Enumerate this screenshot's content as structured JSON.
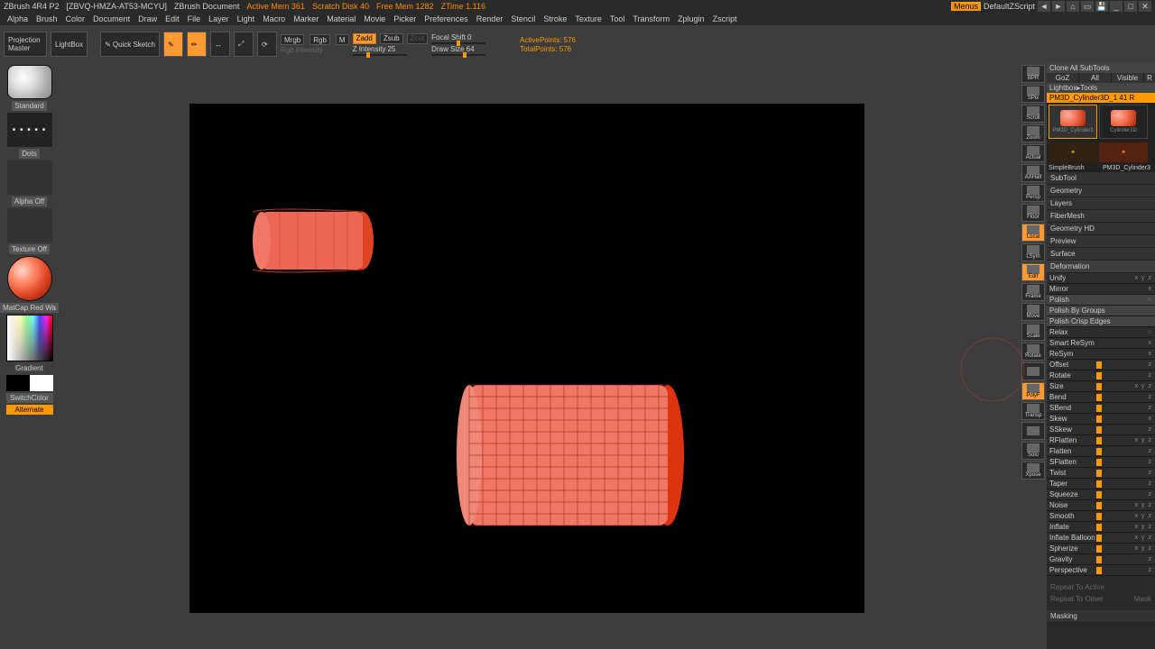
{
  "title": {
    "app": "ZBrush 4R4 P2",
    "doc": "[ZBVQ-HMZA-AT53-MCYU]",
    "doctype": "ZBrush Document",
    "mem": "Active Mem 361",
    "scratch": "Scratch Disk 40",
    "free": "Free Mem 1282",
    "ztime": "ZTime 1.116",
    "menus_btn": "Menus",
    "script_btn": "DefaultZScript"
  },
  "menubar": [
    "Alpha",
    "Brush",
    "Color",
    "Document",
    "Draw",
    "Edit",
    "File",
    "Layer",
    "Light",
    "Macro",
    "Marker",
    "Material",
    "Movie",
    "Picker",
    "Preferences",
    "Render",
    "Stencil",
    "Stroke",
    "Texture",
    "Tool",
    "Transform",
    "Zplugin",
    "Zscript"
  ],
  "shelf": {
    "projection_master": "Projection Master",
    "lightbox": "LightBox",
    "quicksketch": "Quick Sketch",
    "mrgb": "Mrgb",
    "rgb": "Rgb",
    "m": "M",
    "rgb_intensity": "Rgb Intensity",
    "zadd": "Zadd",
    "zsub": "Zsub",
    "zcut": "Zcut",
    "zintensity_label": "Z Intensity",
    "zintensity_val": "25",
    "focal_shift_label": "Focal Shift",
    "focal_shift_val": "0",
    "draw_size_label": "Draw Size",
    "draw_size_val": "64",
    "active_points_label": "ActivePoints:",
    "active_points_val": "576",
    "total_points_label": "TotalPoints:",
    "total_points_val": "576"
  },
  "left": {
    "brush": "Standard",
    "stroke": "Dots",
    "alpha": "Alpha Off",
    "texture": "Texture Off",
    "matcap": "MatCap Red Wa",
    "gradient": "Gradient",
    "switch": "SwitchColor",
    "alternate": "Alternate"
  },
  "right_icons": [
    "BPR",
    "SPix",
    "Scroll",
    "Zoom",
    "Actual",
    "AAHalf",
    "Persp",
    "Floor",
    "Local",
    "LSym",
    "Edit",
    "Frame",
    "Move",
    "Scale",
    "Rotate",
    "",
    "PolyF",
    "Transp",
    "",
    "Solo",
    "Xpose"
  ],
  "right_icons_on": [
    8,
    10,
    16
  ],
  "tool": {
    "clone": "Clone All SubTools",
    "goz": "GoZ",
    "all": "All",
    "visible": "Visible",
    "r": "R",
    "lbtools": "Lightbox▸Tools",
    "current": "PM3D_Cylinder3D_1 41 R",
    "thumbs": [
      "PM3D_Cylinder3",
      "Cylinder3D",
      "SimpleBrush",
      "PM3D_Cylinder3"
    ]
  },
  "sections": [
    "SubTool",
    "Geometry",
    "Layers",
    "FiberMesh",
    "Geometry HD",
    "Preview",
    "Surface"
  ],
  "deformation_title": "Deformation",
  "deformation": [
    {
      "name": "Unify",
      "axis": "xyz"
    },
    {
      "name": "Mirror",
      "axis": "x"
    },
    {
      "name": "Polish",
      "hl": true,
      "circle": true
    },
    {
      "name": "Polish By Groups",
      "hl": true
    },
    {
      "name": "Polish Crisp Edges",
      "hl": true
    },
    {
      "name": "Relax",
      "circle": true
    },
    {
      "name": "Smart ReSym",
      "axis": "x"
    },
    {
      "name": "ReSym",
      "axis": "x"
    },
    {
      "name": "Offset",
      "axis": "z",
      "thumb": 55
    },
    {
      "name": "Rotate",
      "axis": "z",
      "thumb": 55
    },
    {
      "name": "Size",
      "axis": "xyz",
      "thumb": 55
    },
    {
      "name": "Bend",
      "axis": "z",
      "thumb": 55
    },
    {
      "name": "SBend",
      "axis": "z",
      "thumb": 55
    },
    {
      "name": "Skew",
      "axis": "x",
      "thumb": 55
    },
    {
      "name": "SSkew",
      "axis": "z",
      "thumb": 55
    },
    {
      "name": "RFlatten",
      "axis": "xyz",
      "thumb": 55
    },
    {
      "name": "Flatten",
      "axis": "z",
      "thumb": 55
    },
    {
      "name": "SFlatten",
      "axis": "z",
      "thumb": 55
    },
    {
      "name": "Twist",
      "axis": "z",
      "thumb": 55
    },
    {
      "name": "Taper",
      "axis": "z",
      "thumb": 55
    },
    {
      "name": "Squeeze",
      "axis": "z",
      "thumb": 55
    },
    {
      "name": "Noise",
      "axis": "xyz",
      "thumb": 55
    },
    {
      "name": "Smooth",
      "axis": "xyz",
      "thumb": 55
    },
    {
      "name": "Inflate",
      "axis": "xyz",
      "thumb": 55
    },
    {
      "name": "Inflate Balloon",
      "axis": "xyz",
      "thumb": 55
    },
    {
      "name": "Spherize",
      "axis": "xyz",
      "thumb": 55
    },
    {
      "name": "Gravity",
      "axis": "z",
      "thumb": 55
    },
    {
      "name": "Perspective",
      "axis": "z",
      "thumb": 55
    }
  ],
  "repeat": {
    "active": "Repeat To Active",
    "other": "Repeat To Other",
    "mask": "Mask"
  },
  "masking_title": "Masking"
}
